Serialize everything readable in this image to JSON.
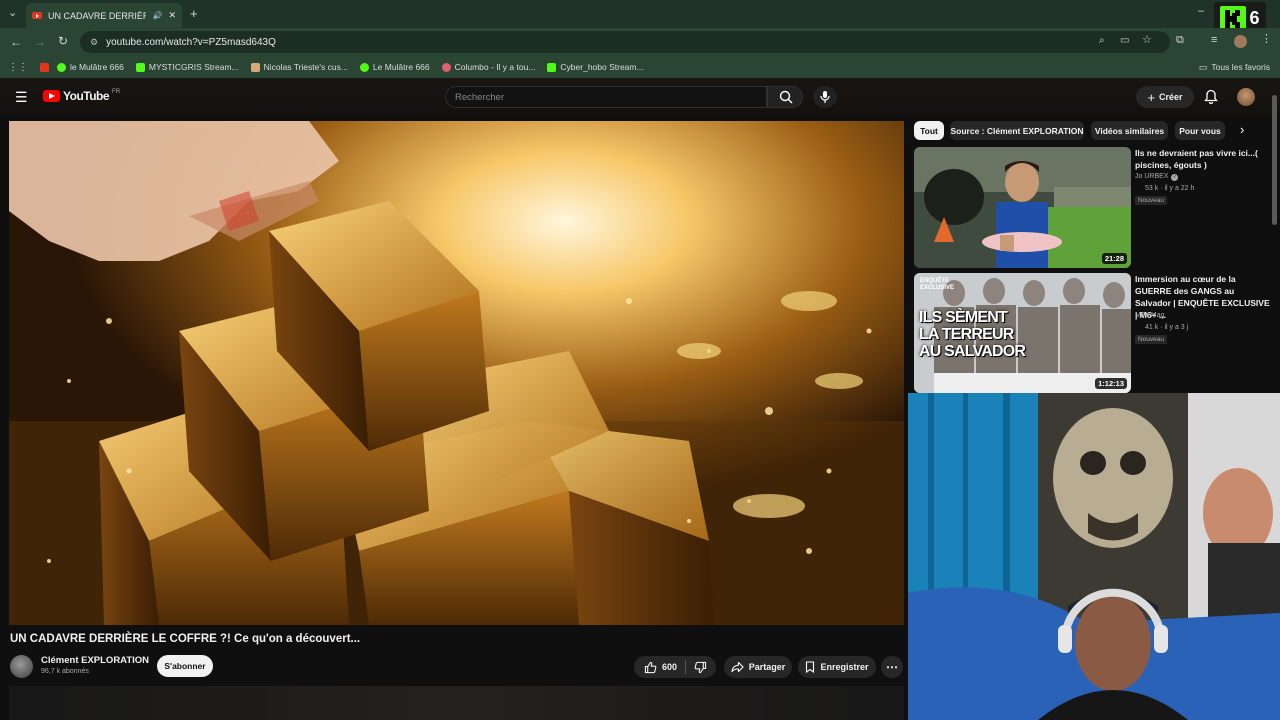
{
  "browser": {
    "tab_title": "UN CADAVRE DERRIÈRE LE",
    "url": "youtube.com/watch?v=PZ5masd643Q",
    "bookmarks": [
      {
        "label": "",
        "color": "#e8341c"
      },
      {
        "label": "le Mulâtre 666",
        "color": "#53fc18"
      },
      {
        "label": "MYSTICGRIS Stream...",
        "color": "#53fc18"
      },
      {
        "label": "Nicolas Trieste's cus...",
        "color": "#d8a878"
      },
      {
        "label": "Le Mulâtre 666",
        "color": "#53fc18"
      },
      {
        "label": "Columbo - Il y a tou...",
        "color": "#e06070"
      },
      {
        "label": "Cyber_hobo Stream...",
        "color": "#53fc18"
      }
    ],
    "all_bookmarks_label": "Tous les favoris",
    "kick_overlay_number": "6"
  },
  "youtube": {
    "logo_text": "YouTube",
    "logo_region": "FR",
    "search_placeholder": "Rechercher",
    "create_label": "Créer"
  },
  "video": {
    "title": "UN CADAVRE DERRIÈRE LE COFFRE ?! Ce qu'on a découvert...",
    "channel": "Clément EXPLORATION",
    "subscribers": "96,7 k abonnés",
    "subscribe_label": "S'abonner",
    "likes": "600",
    "share_label": "Partager",
    "save_label": "Enregistrer"
  },
  "sidebar": {
    "chips": [
      "Tout",
      "Source : Clément EXPLORATION",
      "Vidéos similaires",
      "Pour vous"
    ],
    "recommendations": [
      {
        "title": "Ils ne devraient pas vivre ici...( piscines, égouts )",
        "channel": "Jo URBEX",
        "meta": "53 k · il y a 22 h",
        "badge": "Nouveau",
        "duration": "21:28"
      },
      {
        "title": "Immersion au cœur de la GUERRE des GANGS au Salvador | ENQUÊTE EXCLUSIVE | M6+ ...",
        "channel": "M6+ Mag",
        "meta": "41 k · il y a 3 j",
        "badge": "Nouveau",
        "duration": "1:12:13",
        "thumb_text": [
          "ENQUÊTE",
          "EXCLUSIVE",
          "ILS SÈMENT",
          "LA TERREUR",
          "AU SALVADOR"
        ]
      }
    ]
  }
}
